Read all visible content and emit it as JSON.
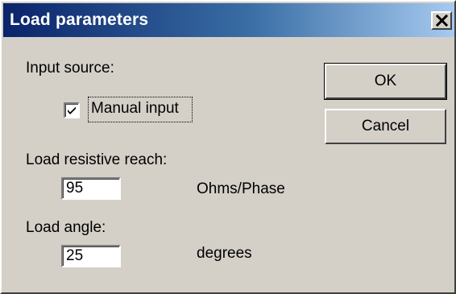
{
  "window": {
    "title": "Load parameters",
    "close_icon": "close-icon"
  },
  "input_source": {
    "label": "Input source:",
    "manual_checkbox": {
      "label": "Manual input",
      "checked": true
    }
  },
  "load_resistive_reach": {
    "label": "Load resistive reach:",
    "value": "95",
    "unit": "Ohms/Phase"
  },
  "load_angle": {
    "label": "Load angle:",
    "value": "25",
    "unit": "degrees"
  },
  "buttons": {
    "ok": "OK",
    "cancel": "Cancel"
  },
  "colors": {
    "titlebar_start": "#0a246a",
    "titlebar_end": "#a6caf0",
    "face": "#d4d0c8"
  }
}
